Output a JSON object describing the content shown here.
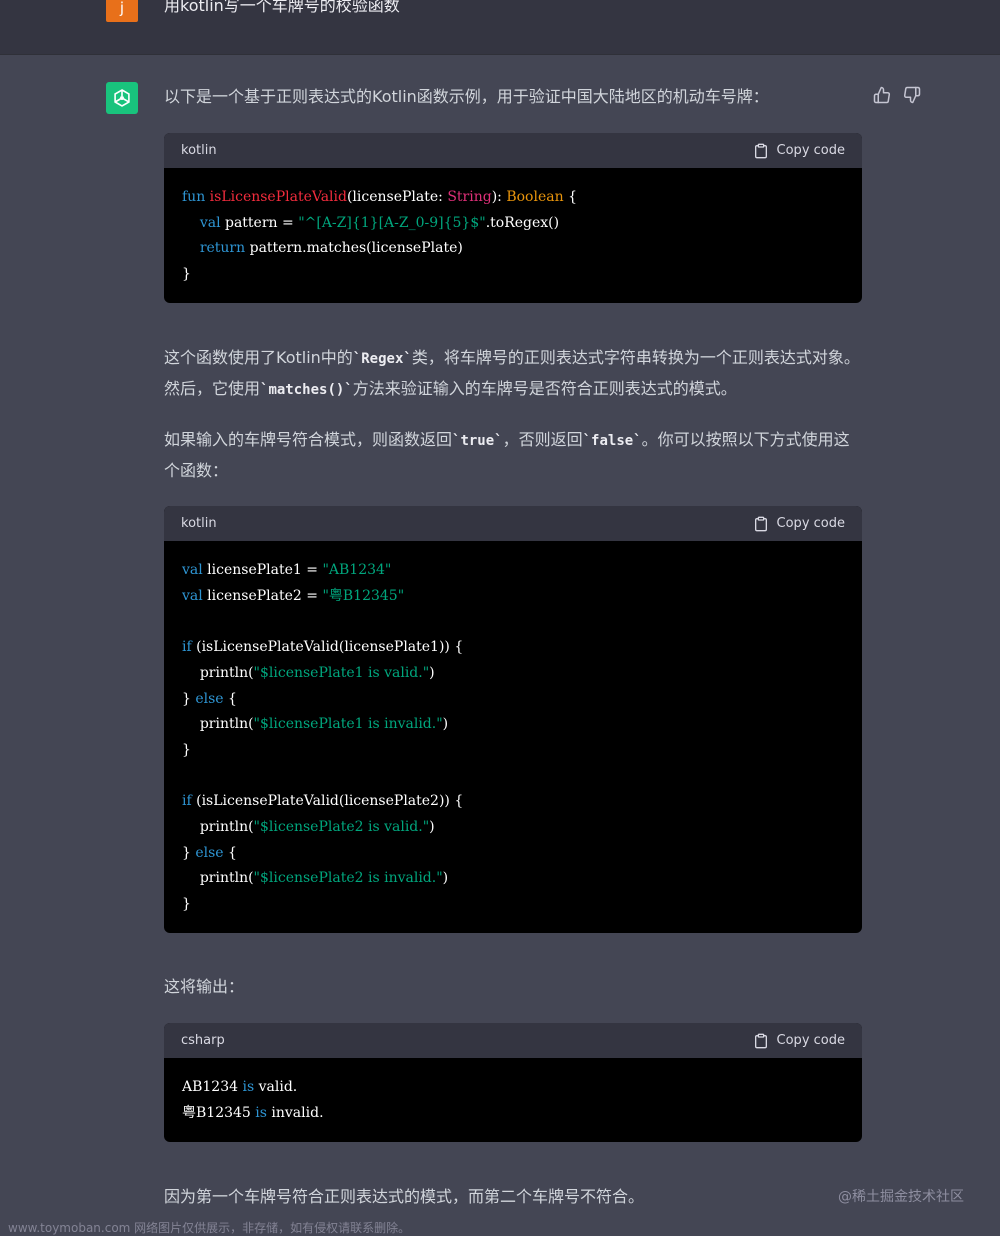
{
  "user": {
    "avatar_letter": "j",
    "message": "用kotlin写一个车牌号的校验函数"
  },
  "assistant": {
    "intro": "以下是一个基于正则表达式的Kotlin函数示例，用于验证中国大陆地区的机动车号牌：",
    "para1": {
      "part1": "这个函数使用了Kotlin中的",
      "code1": "`Regex`",
      "part2": "类，将车牌号的正则表达式字符串转换为一个正则表达式对象。然后，它使用",
      "code2": "`matches()`",
      "part3": "方法来验证输入的车牌号是否符合正则表达式的模式。"
    },
    "para2": {
      "part1": "如果输入的车牌号符合模式，则函数返回",
      "code1": "`true`",
      "part2": "，否则返回",
      "code2": "`false`",
      "part3": "。你可以按照以下方式使用这个函数："
    },
    "output_label": "这将输出：",
    "conclusion": "因为第一个车牌号符合正则表达式的模式，而第二个车牌号不符合。"
  },
  "code_blocks": [
    {
      "language": "kotlin",
      "copy_label": "Copy code"
    },
    {
      "language": "kotlin",
      "copy_label": "Copy code"
    },
    {
      "language": "csharp",
      "copy_label": "Copy code"
    }
  ],
  "code1": {
    "l1_kw": "fun",
    "l1_fn": "isLicensePlateValid",
    "l1_p1": "(licensePlate: ",
    "l1_ty": "String",
    "l1_p2": "): ",
    "l1_bl": "Boolean",
    "l1_p3": " {",
    "l2_kw": "val",
    "l2_p1": " pattern = ",
    "l2_st": "\"^[A-Z]{1}[A-Z_0-9]{5}$\"",
    "l2_p2": ".toRegex()",
    "l3_kw": "return",
    "l3_p1": " pattern.matches(licensePlate)",
    "l4": "}"
  },
  "code2": {
    "l1_kw": "val",
    "l1_p1": " licensePlate1 = ",
    "l1_st": "\"AB1234\"",
    "l2_kw": "val",
    "l2_p1": " licensePlate2 = ",
    "l2_st": "\"粤B12345\"",
    "if_kw": "if",
    "if1_p": " (isLicensePlateValid(licensePlate1)) {",
    "println": "println(",
    "s_valid1": "\"$licensePlate1 is valid.\"",
    "s_invalid1": "\"$licensePlate1 is invalid.\"",
    "close_paren": ")",
    "else_open": "} ",
    "else_kw": "else",
    "else_brace": " {",
    "close": "}",
    "if2_p": " (isLicensePlateValid(licensePlate2)) {",
    "s_valid2": "\"$licensePlate2 is valid.\"",
    "s_invalid2": "\"$licensePlate2 is invalid.\""
  },
  "code3": {
    "l1_a": "AB1234 ",
    "is": "is",
    "l1_b": " valid.",
    "l2_a": "粤B12345 ",
    "l2_b": " invalid."
  },
  "watermarks": {
    "right": "@稀土掘金技术社区",
    "bottom": "www.toymoban.com 网络图片仅供展示，非存储，如有侵权请联系删除。"
  }
}
